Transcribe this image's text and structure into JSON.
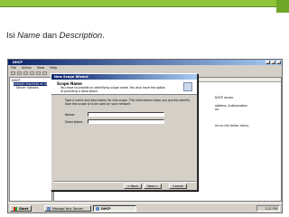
{
  "slide": {
    "caption_prefix": "Isi ",
    "caption_name": "Name",
    "caption_mid": " dan ",
    "caption_desc": "Description",
    "caption_suffix": ".",
    "accent_color": "#8fc53a"
  },
  "main_window": {
    "title": "DHCP",
    "menu": [
      "File",
      "Action",
      "View",
      "Help"
    ],
    "tree": [
      "DHCP",
      "sekolah.fajarindo.ac.id",
      "Server Options"
    ],
    "right_header": "sekolah.fajarindo.ac.id [192.168.10.1]",
    "right_lines": [
      "DHCP server,",
      "address, Authorization",
      "on.",
      "",
      "ick on the Action menu,"
    ]
  },
  "wizard": {
    "title": "New Scope Wizard",
    "heading": "Scope Name",
    "header_desc": "You have to provide an identifying scope name. You also have the option of providing a description.",
    "body_text": "Type a name and description for this scope. This information helps you quickly identify how this scope is to be used on your network.",
    "name_label": "Name:",
    "name_value": "",
    "description_label": "Description:",
    "description_value": "",
    "back_label": "< Back",
    "next_label": "Next >",
    "cancel_label": "Cancel"
  },
  "taskbar": {
    "start_label": "Start",
    "tasks": [
      "Manage Your Server",
      "DHCP"
    ],
    "clock": "1:21 PM"
  }
}
